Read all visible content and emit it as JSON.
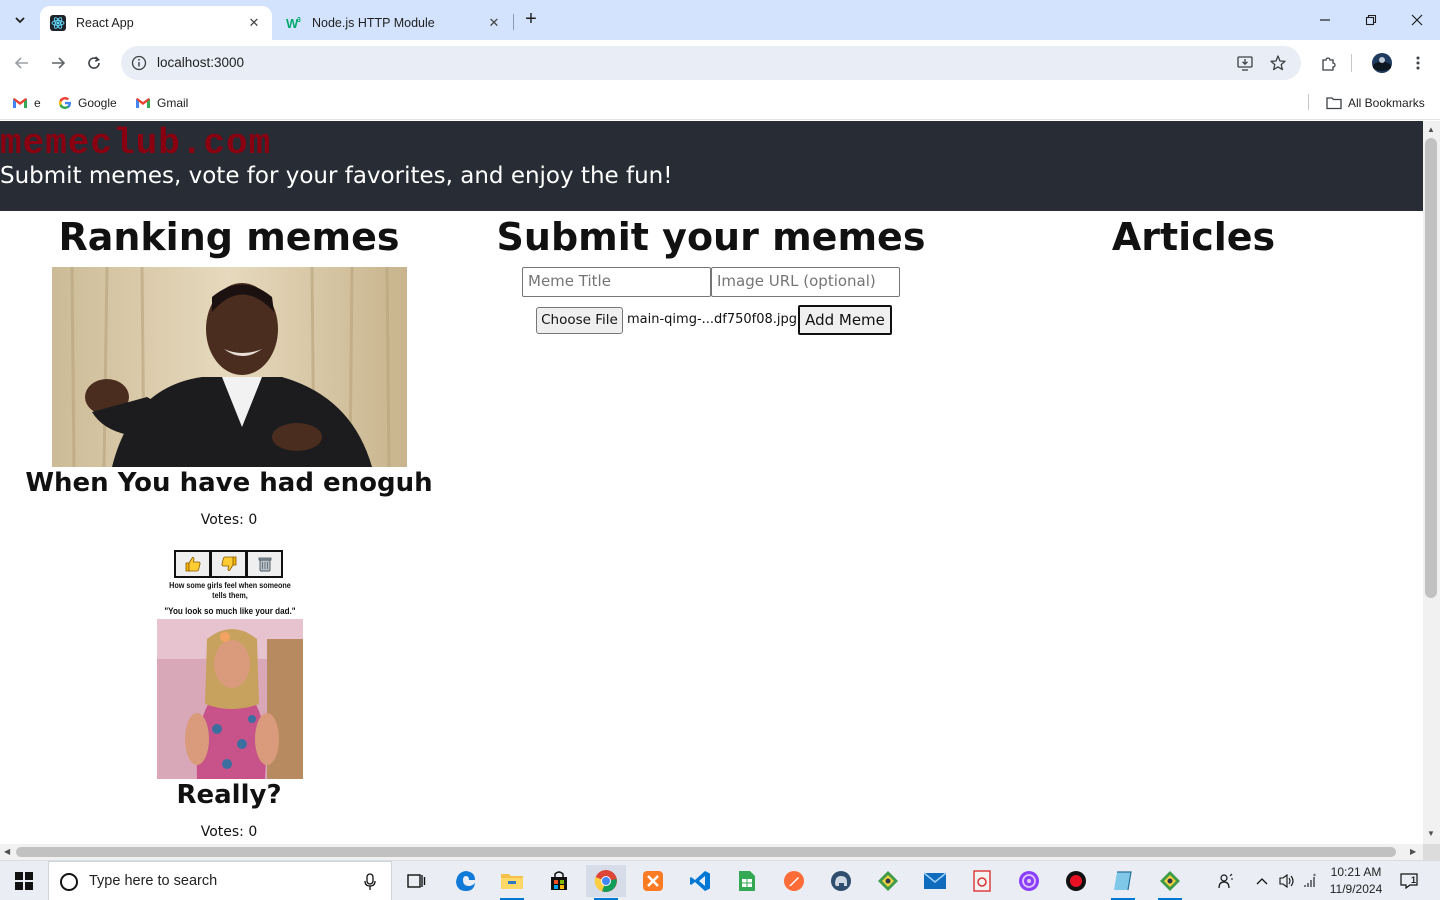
{
  "browser": {
    "tabs": [
      {
        "title": "React App",
        "active": true,
        "favicon": "react-icon"
      },
      {
        "title": "Node.js HTTP Module",
        "active": false,
        "favicon": "w3schools-icon"
      }
    ],
    "address": "localhost:3000",
    "bookmarks": [
      {
        "label": "e",
        "icon": "gmail-icon"
      },
      {
        "label": "Google",
        "icon": "google-icon"
      },
      {
        "label": "Gmail",
        "icon": "gmail-icon"
      }
    ],
    "all_bookmarks_label": "All Bookmarks"
  },
  "site": {
    "logo": "memeclub.com",
    "tagline": "Submit memes, vote for your favorites, and enjoy the fun!",
    "colors": {
      "header_bg": "#282c34",
      "logo": "#8b0010"
    }
  },
  "ranking": {
    "heading": "Ranking memes",
    "memes": [
      {
        "title": "When You have had enoguh",
        "votes_text": "Votes: 0"
      },
      {
        "title": "Really?",
        "votes_text": "Votes: 0",
        "caption_line1": "How some girls feel when someone tells them,",
        "caption_line2": "\"You look so much like your dad.\""
      }
    ],
    "vote_buttons": [
      "thumbs-up-icon",
      "thumbs-down-icon",
      "trash-icon"
    ]
  },
  "submit": {
    "heading": "Submit your memes",
    "title_placeholder": "Meme Title",
    "url_placeholder": "Image URL (optional)",
    "file_button": "Choose File",
    "file_name": "main-qimg-...df750f08.jpg",
    "add_button": "Add Meme"
  },
  "articles": {
    "heading": "Articles"
  },
  "taskbar": {
    "search_placeholder": "Type here to search",
    "time": "10:21 AM",
    "date": "11/9/2024",
    "notification_count": "1"
  }
}
